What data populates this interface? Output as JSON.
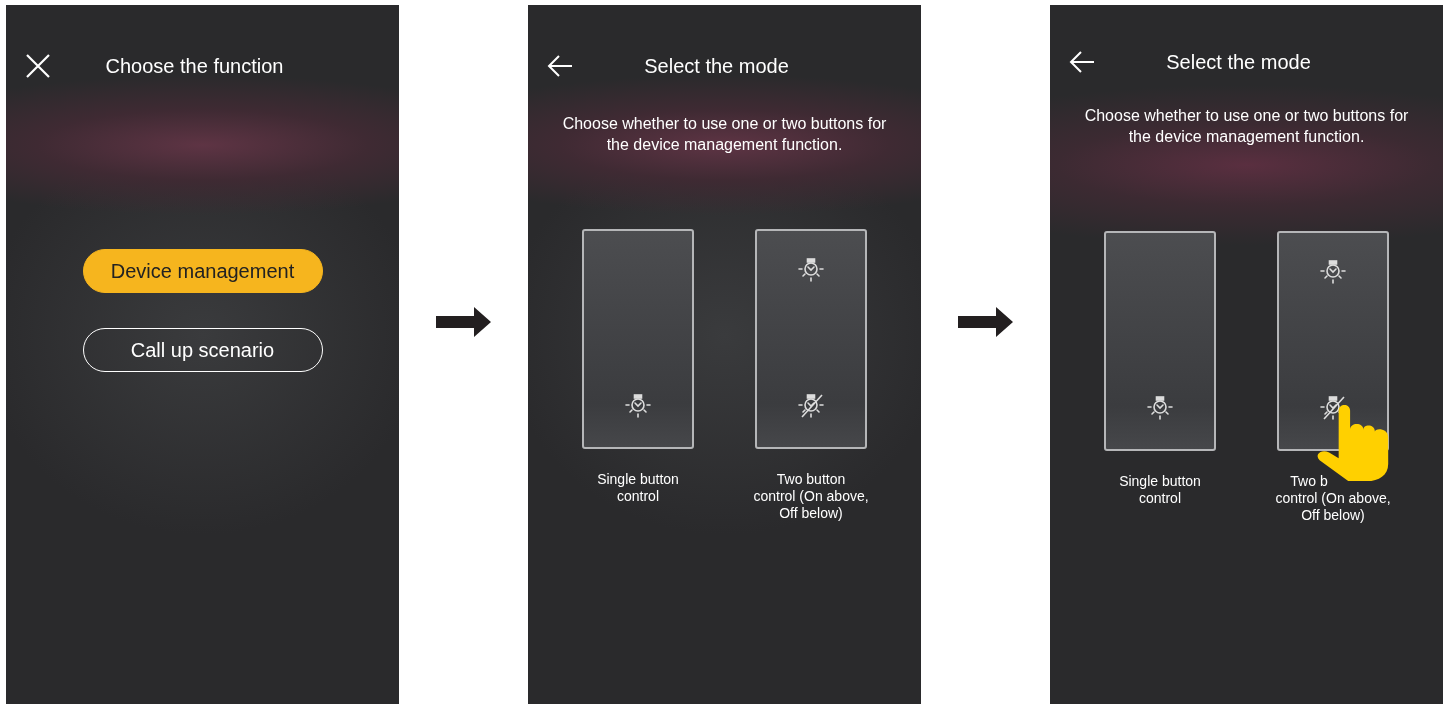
{
  "screens": [
    {
      "kind": "function",
      "title": "Choose the function",
      "options": [
        {
          "label": "Device management",
          "selected": true
        },
        {
          "label": "Call up scenario",
          "selected": false
        }
      ]
    },
    {
      "kind": "mode",
      "title": "Select the mode",
      "description": "Choose whether to use one or two buttons for the device management function.",
      "touch": false,
      "modes": [
        {
          "kind": "single",
          "label_lines": [
            "Single button",
            "control"
          ]
        },
        {
          "kind": "double",
          "label_lines": [
            "Two button",
            "control (On above,",
            "Off below)"
          ]
        }
      ]
    },
    {
      "kind": "mode",
      "title": "Select the mode",
      "description": "Choose whether to use one or two buttons for the device management function.",
      "touch": true,
      "modes": [
        {
          "kind": "single",
          "label_lines": [
            "Single button",
            "control"
          ]
        },
        {
          "kind": "double",
          "label_lines": [
            "Two b",
            "control (On above,",
            "Off below)"
          ]
        }
      ]
    }
  ]
}
